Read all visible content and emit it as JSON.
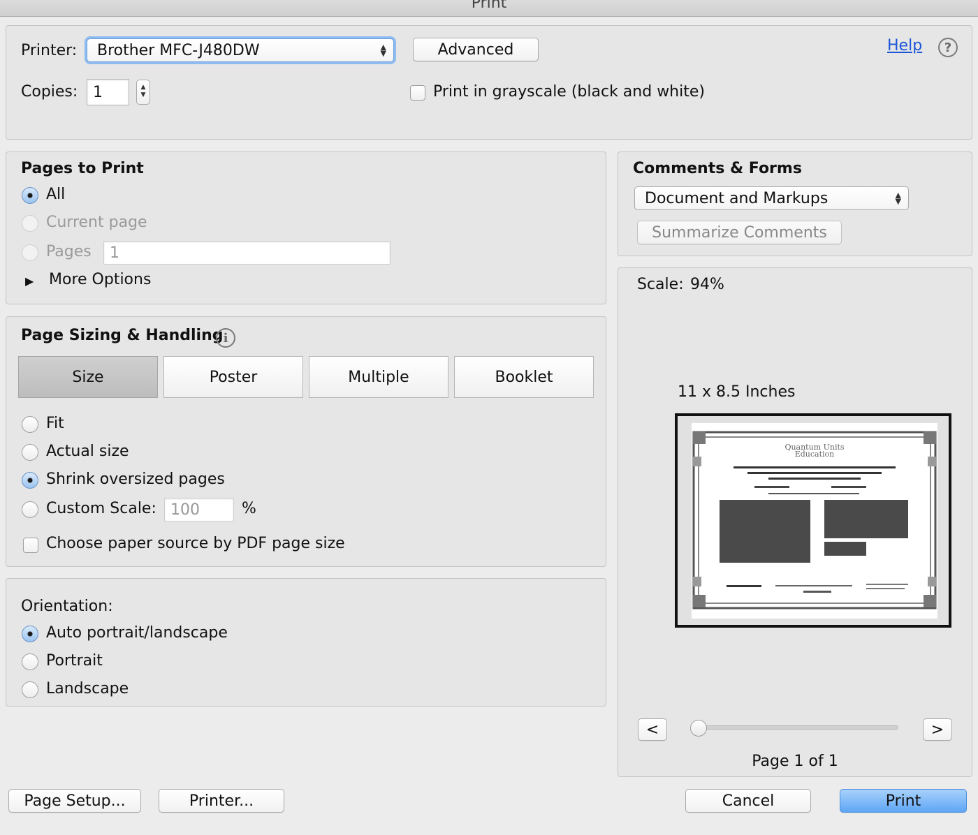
{
  "window": {
    "title": "Print"
  },
  "printer": {
    "label": "Printer:",
    "selected": "Brother MFC-J480DW",
    "advanced_label": "Advanced",
    "help_label": "Help",
    "copies_label": "Copies:",
    "copies_value": "1",
    "grayscale_label": "Print in grayscale (black and white)",
    "grayscale_checked": false
  },
  "pages_to_print": {
    "heading": "Pages to Print",
    "options": [
      "All",
      "Current page",
      "Pages"
    ],
    "selected": "All",
    "pages_value": "1",
    "more_options_label": "More Options"
  },
  "page_sizing": {
    "heading": "Page Sizing & Handling",
    "tabs": [
      "Size",
      "Poster",
      "Multiple",
      "Booklet"
    ],
    "active_tab": "Size",
    "options": [
      "Fit",
      "Actual size",
      "Shrink oversized pages",
      "Custom Scale:"
    ],
    "selected": "Shrink oversized pages",
    "custom_scale_value": "100",
    "percent_symbol": "%",
    "paper_source_label": "Choose paper source by PDF page size",
    "paper_source_checked": false
  },
  "orientation": {
    "heading": "Orientation:",
    "options": [
      "Auto portrait/landscape",
      "Portrait",
      "Landscape"
    ],
    "selected": "Auto portrait/landscape"
  },
  "comments_forms": {
    "heading": "Comments & Forms",
    "selected": "Document and Markups",
    "summarize_label": "Summarize Comments"
  },
  "preview": {
    "scale_label": "Scale:",
    "scale_value": "94%",
    "paper_size": "11 x 8.5 Inches",
    "prev_label": "<",
    "next_label": ">",
    "page_indicator": "Page 1 of 1",
    "page_position": 0,
    "doc_title_line1": "Quantum Units",
    "doc_title_line2": "Education"
  },
  "footer": {
    "page_setup_label": "Page Setup...",
    "printer_label": "Printer...",
    "cancel_label": "Cancel",
    "print_label": "Print"
  },
  "colors": {
    "accent": "#5ea6f5",
    "link": "#1a56d6",
    "panel_bg": "#e6e6e6"
  }
}
